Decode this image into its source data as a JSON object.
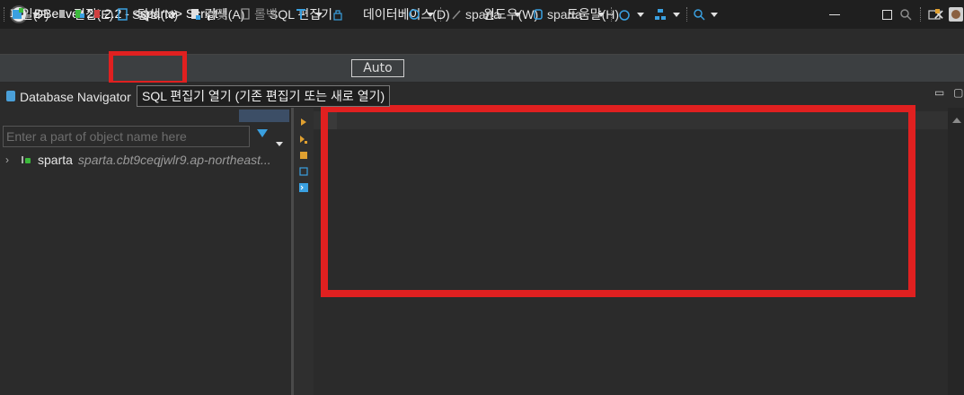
{
  "window": {
    "title": "DBeaver 24.2.2 - <sparta> Script",
    "minimize_symbol": "",
    "maximize_symbol": "",
    "close_symbol": "✕"
  },
  "menu": {
    "items": [
      {
        "label": "파일(F)"
      },
      {
        "label": "편집(E)"
      },
      {
        "label": "탐색(N)"
      },
      {
        "label": "검색(A)"
      },
      {
        "label": "SQL 편집기"
      },
      {
        "label": "데이터베이스(D)"
      },
      {
        "label": "윈도우(W)"
      },
      {
        "label": "도움말(H)"
      }
    ]
  },
  "toolbar": {
    "sql_label": "SQL",
    "commit_label": "커밋",
    "rollback_label": "롤백",
    "transaction_mode": "Auto",
    "datasource": "sparta",
    "schema": "sparta"
  },
  "navigator": {
    "tab_label": "Database Navigator",
    "filter_placeholder": "Enter a part of object name here",
    "filter_value": "",
    "tree": [
      {
        "name": "sparta",
        "host": "sparta.cbt9ceqjwlr9.ap-northeast..."
      }
    ]
  },
  "tooltip": {
    "text": "SQL 편집기 열기 (기존 편집기 또는 새로 열기)"
  },
  "colors": {
    "highlight_red": "#e02020",
    "accent_blue": "#3aa0e0",
    "connected_green": "#3cba3c"
  }
}
